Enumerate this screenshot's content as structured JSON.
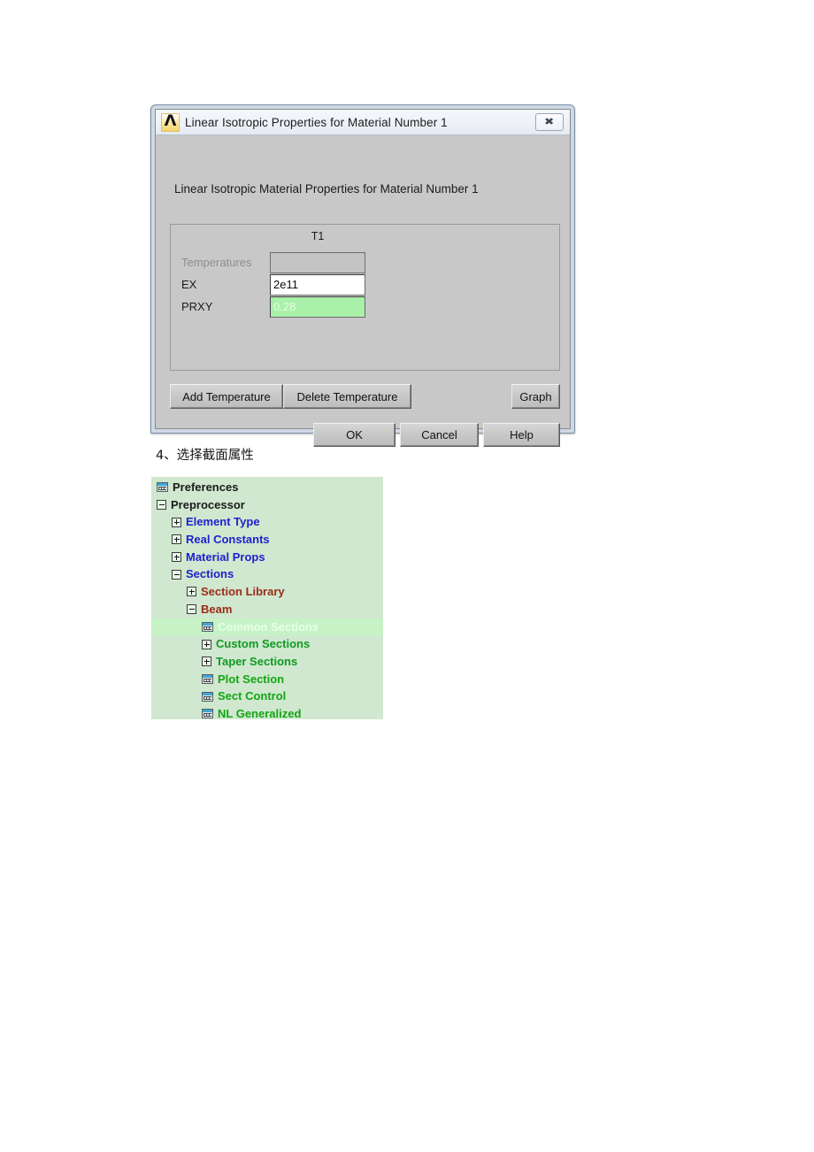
{
  "dialog": {
    "title": "Linear Isotropic Properties for Material Number 1",
    "logo_glyph": "Λ",
    "close_glyph": "✖",
    "prompt": "Linear Isotropic Material Properties for Material Number 1",
    "column_header": "T1",
    "rows": [
      {
        "label": "Temperatures",
        "value": "",
        "state": "disabled"
      },
      {
        "label": "EX",
        "value": "2e11",
        "state": "active"
      },
      {
        "label": "PRXY",
        "value": "0.28",
        "state": "selected"
      }
    ],
    "buttons": {
      "add_temperature": "Add Temperature",
      "delete_temperature": "Delete Temperature",
      "graph": "Graph",
      "ok": "OK",
      "cancel": "Cancel",
      "help": "Help"
    }
  },
  "caption": "4、选择截面属性",
  "tree": {
    "background_color": "#cfe8cf",
    "items": [
      {
        "label": "Preferences",
        "indent": 0,
        "marker": "icon",
        "color": "c-dark",
        "highlighted": false
      },
      {
        "label": "Preprocessor",
        "indent": 0,
        "marker": "minus",
        "color": "c-dark",
        "highlighted": false
      },
      {
        "label": "Element Type",
        "indent": 1,
        "marker": "plus",
        "color": "c-blue",
        "highlighted": false
      },
      {
        "label": "Real Constants",
        "indent": 1,
        "marker": "plus",
        "color": "c-blue",
        "highlighted": false
      },
      {
        "label": "Material Props",
        "indent": 1,
        "marker": "plus",
        "color": "c-blue",
        "highlighted": false
      },
      {
        "label": "Sections",
        "indent": 1,
        "marker": "minus",
        "color": "c-blue",
        "highlighted": false
      },
      {
        "label": "Section Library",
        "indent": 2,
        "marker": "plus",
        "color": "c-red",
        "highlighted": false
      },
      {
        "label": "Beam",
        "indent": 2,
        "marker": "minus",
        "color": "c-red",
        "highlighted": false
      },
      {
        "label": "Common Sections",
        "indent": 3,
        "marker": "icon",
        "color": "c-hl",
        "highlighted": true
      },
      {
        "label": "Custom Sections",
        "indent": 3,
        "marker": "plus",
        "color": "c-dgreen",
        "highlighted": false
      },
      {
        "label": "Taper Sections",
        "indent": 3,
        "marker": "plus",
        "color": "c-dgreen",
        "highlighted": false
      },
      {
        "label": "Plot Section",
        "indent": 3,
        "marker": "icon",
        "color": "c-green",
        "highlighted": false
      },
      {
        "label": "Sect Control",
        "indent": 3,
        "marker": "icon",
        "color": "c-green",
        "highlighted": false
      },
      {
        "label": "NL Generalized",
        "indent": 3,
        "marker": "icon",
        "color": "c-green",
        "highlighted": false
      }
    ]
  }
}
